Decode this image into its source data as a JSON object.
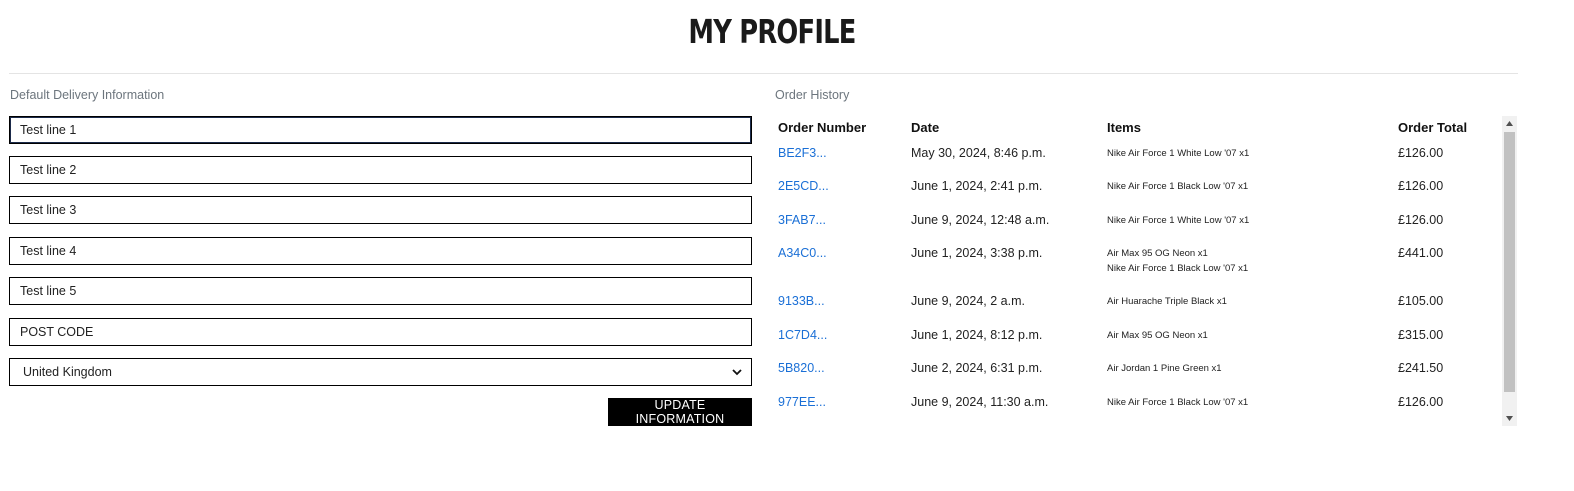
{
  "title": "MY PROFILE",
  "delivery": {
    "label": "Default Delivery Information",
    "line1": "Test line 1",
    "line2": "Test line 2",
    "line3": "Test line 3",
    "line4": "Test line 4",
    "line5": "Test line 5",
    "postcode": "POST CODE",
    "country": "United Kingdom",
    "update_label": "UPDATE INFORMATION"
  },
  "orders": {
    "label": "Order History",
    "headers": {
      "number": "Order Number",
      "date": "Date",
      "items": "Items",
      "total": "Order Total"
    },
    "rows": [
      {
        "number": "BE2F3...",
        "date": "May 30, 2024, 8:46 p.m.",
        "items": [
          "Nike Air Force 1 White Low '07 x1"
        ],
        "total": "£126.00"
      },
      {
        "number": "2E5CD...",
        "date": "June 1, 2024, 2:41 p.m.",
        "items": [
          "Nike Air Force 1 Black Low '07 x1"
        ],
        "total": "£126.00"
      },
      {
        "number": "3FAB7...",
        "date": "June 9, 2024, 12:48 a.m.",
        "items": [
          "Nike Air Force 1 White Low '07 x1"
        ],
        "total": "£126.00"
      },
      {
        "number": "A34C0...",
        "date": "June 1, 2024, 3:38 p.m.",
        "items": [
          "Air Max 95 OG Neon x1",
          "Nike Air Force 1 Black Low '07 x1"
        ],
        "total": "£441.00"
      },
      {
        "number": "9133B...",
        "date": "June 9, 2024, 2 a.m.",
        "items": [
          "Air Huarache Triple Black x1"
        ],
        "total": "£105.00"
      },
      {
        "number": "1C7D4...",
        "date": "June 1, 2024, 8:12 p.m.",
        "items": [
          "Air Max 95 OG Neon x1"
        ],
        "total": "£315.00"
      },
      {
        "number": "5B820...",
        "date": "June 2, 2024, 6:31 p.m.",
        "items": [
          "Air Jordan 1 Pine Green x1"
        ],
        "total": "£241.50"
      },
      {
        "number": "977EE...",
        "date": "June 9, 2024, 11:30 a.m.",
        "items": [
          "Nike Air Force 1 Black Low '07 x1"
        ],
        "total": "£126.00"
      }
    ]
  },
  "colors": {
    "link": "#1a6fd6",
    "button_bg": "#000000",
    "label": "#6c757d"
  },
  "icons": {
    "select": "chevron-down-icon",
    "scroll_up": "scroll-up-arrow-icon",
    "scroll_down": "scroll-down-arrow-icon"
  }
}
